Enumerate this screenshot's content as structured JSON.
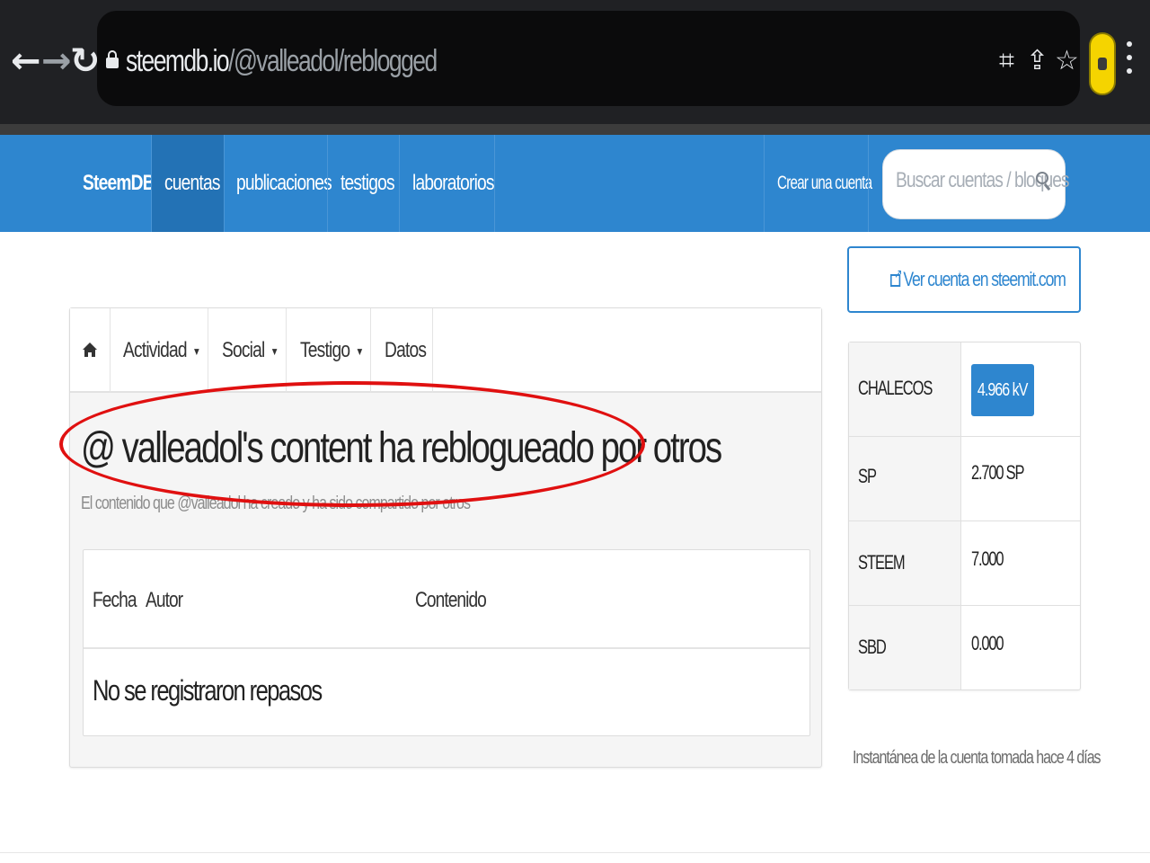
{
  "browser": {
    "url_host": "steemdb.io",
    "url_path": "/@valleadol/reblogged"
  },
  "navbar": {
    "brand": "SteemDB",
    "items": [
      {
        "label": "cuentas",
        "active": true
      },
      {
        "label": "publicaciones",
        "active": false
      },
      {
        "label": "testigos",
        "active": false
      },
      {
        "label": "laboratorios",
        "active": false
      }
    ],
    "create_account": "Crear una cuenta",
    "search_placeholder": "Buscar cuentas / bloques"
  },
  "tabs": {
    "home_icon": "home-icon",
    "items": [
      {
        "label": "Actividad",
        "dropdown": true
      },
      {
        "label": "Social",
        "dropdown": true
      },
      {
        "label": "Testigo",
        "dropdown": true
      },
      {
        "label": "Datos",
        "dropdown": false
      }
    ]
  },
  "main": {
    "title": "@ valleadol's content ha reblogueado por otros",
    "subtitle": "El contenido que @valleadol ha creado y ha sido compartido por otros",
    "table": {
      "columns": [
        "Fecha",
        "Autor",
        "Contenido"
      ],
      "empty_message": "No se registraron repasos"
    }
  },
  "sidebar": {
    "view_on_steemit": "Ver cuenta en steemit.com",
    "stats": [
      {
        "label": "CHALECOS",
        "value": "4.966 kV"
      },
      {
        "label": "SP",
        "value": "2.700 SP"
      },
      {
        "label": "STEEM",
        "value": "7.000"
      },
      {
        "label": "SBD",
        "value": "0.000"
      }
    ],
    "snapshot_note": "Instantánea de la cuenta tomada hace 4 días"
  },
  "colors": {
    "brand_blue": "#2e86cf",
    "annotation_red": "#e01010"
  }
}
